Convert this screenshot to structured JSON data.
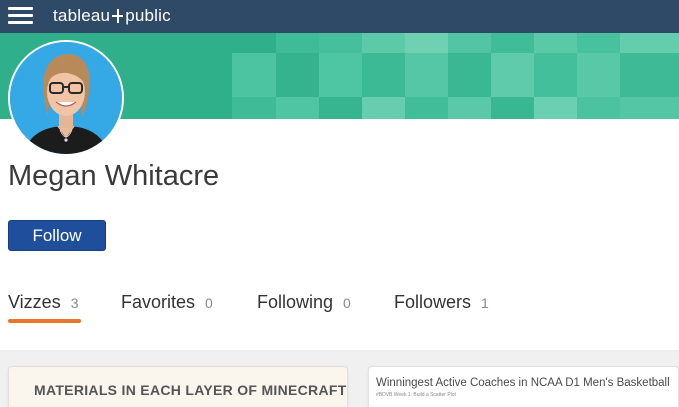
{
  "header": {
    "menu_icon": "hamburger-menu-icon",
    "logo_text_before": "tableau",
    "logo_text_after": "public",
    "background_color": "#2e4a66"
  },
  "banner": {
    "color": "#2fb08a"
  },
  "profile": {
    "name": "Megan Whitacre",
    "avatar_icon": "profile-photo",
    "follow_label": "Follow",
    "follow_color": "#1f4e9c"
  },
  "tabs": [
    {
      "label": "Vizzes",
      "count": "3",
      "active": true
    },
    {
      "label": "Favorites",
      "count": "0",
      "active": false
    },
    {
      "label": "Following",
      "count": "0",
      "active": false
    },
    {
      "label": "Followers",
      "count": "1",
      "active": false
    }
  ],
  "active_tab_color": "#e8762d",
  "vizzes": [
    {
      "title": "MATERIALS IN EACH LAYER OF MINECRAFT"
    },
    {
      "title": "Winningest Active Coaches in NCAA D1 Men's Basketball",
      "subtitle": "#BDVB Week 1: Build a Scatter Plot"
    }
  ]
}
